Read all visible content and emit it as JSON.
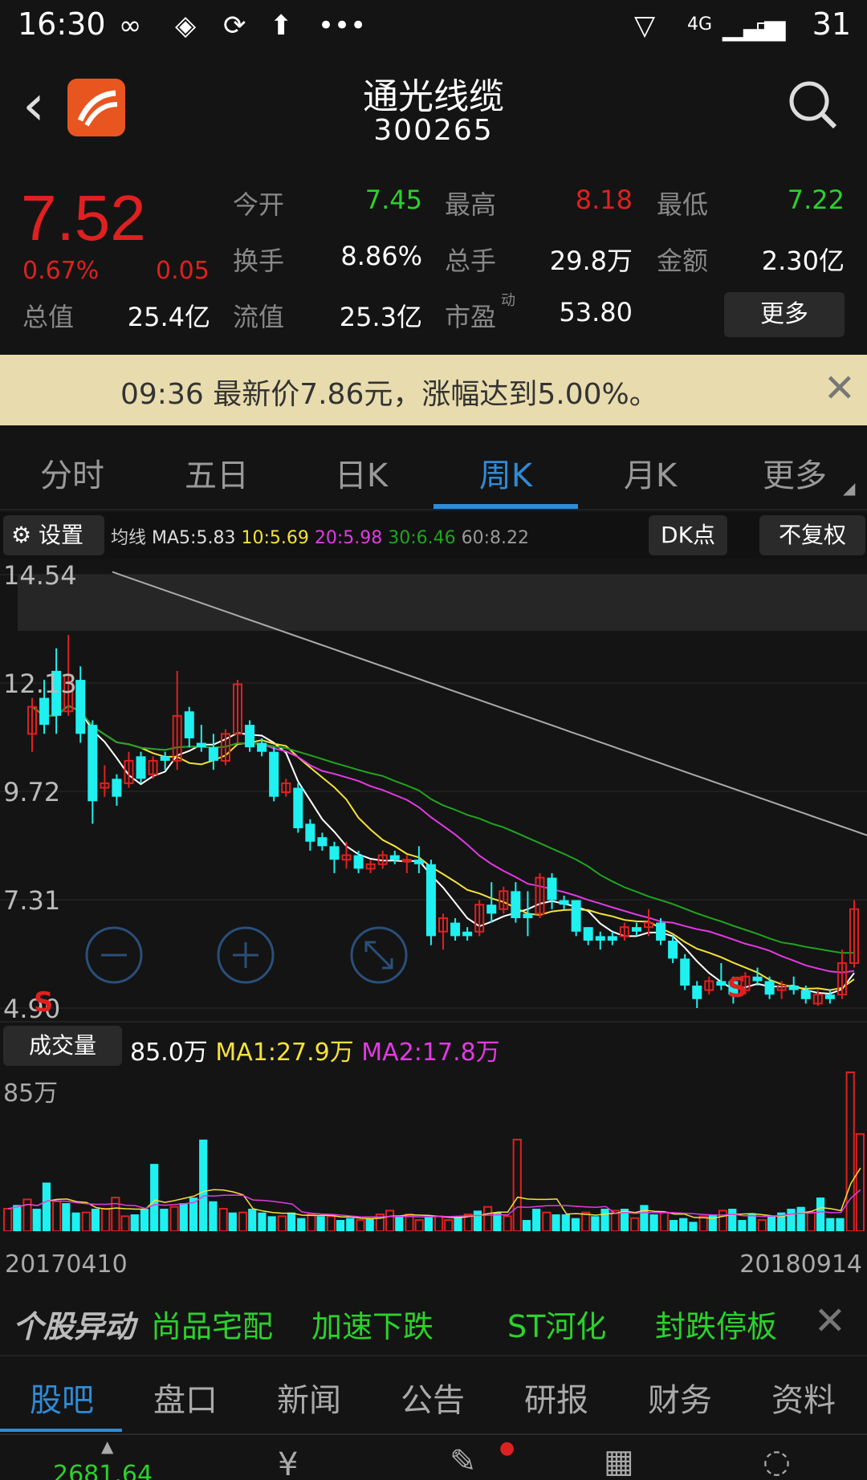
{
  "status": {
    "time": "16:30",
    "battery": "31",
    "network": "4G"
  },
  "header": {
    "name": "通光线缆",
    "code": "300265"
  },
  "quote": {
    "price": "7.52",
    "pct": "0.67%",
    "chg": "0.05",
    "rows": [
      {
        "label": "今开",
        "value": "7.45",
        "color": "green"
      },
      {
        "label": "最高",
        "value": "8.18",
        "color": "red"
      },
      {
        "label": "最低",
        "value": "7.22",
        "color": "green"
      },
      {
        "label": "换手",
        "value": "8.86%",
        "color": "white"
      },
      {
        "label": "总手",
        "value": "29.8万",
        "color": "white"
      },
      {
        "label": "金额",
        "value": "2.30亿",
        "color": "white"
      },
      {
        "label": "总值",
        "value": "25.4亿",
        "color": "white"
      },
      {
        "label": "流值",
        "value": "25.3亿",
        "color": "white"
      },
      {
        "label": "市盈",
        "value": "53.80",
        "color": "white",
        "sup": "动"
      }
    ],
    "more_btn": "更多"
  },
  "alert": {
    "text": "09:36 最新价7.86元，涨幅达到5.00%。"
  },
  "tabs": [
    "分时",
    "五日",
    "日K",
    "周K",
    "月K",
    "更多"
  ],
  "active_tab": "周K",
  "ma_bar": {
    "settings": "设置",
    "label": "均线",
    "ma5": "MA5:5.83",
    "ma10": "10:5.69",
    "ma20": "20:5.98",
    "ma30": "30:6.46",
    "ma60": "60:8.22",
    "dk": "DK点",
    "fq": "不复权"
  },
  "colors": {
    "ma5": "#ffffff",
    "ma10": "#f4e23a",
    "ma20": "#e23ae2",
    "ma30": "#1fa51f",
    "ma60": "#aaaaaa",
    "up": "#e02020",
    "down": "#1ff0f0"
  },
  "chart_labels": {
    "y": [
      "14.54",
      "12.13",
      "9.72",
      "7.31",
      "4.90"
    ],
    "s_marks": [
      "S",
      "S"
    ]
  },
  "volume": {
    "btn": "成交量",
    "vol": "85.0万",
    "ma1": "MA1:27.9万",
    "ma2": "MA2:17.8万",
    "max_label": "85万"
  },
  "dates": {
    "start": "20170410",
    "end": "20180914"
  },
  "movers": {
    "label": "个股异动",
    "items": [
      "尚品宅配",
      "加速下跌",
      "ST河化",
      "封跌停板"
    ]
  },
  "bottom_tabs": [
    "股吧",
    "盘口",
    "新闻",
    "公告",
    "研报",
    "财务",
    "资料"
  ],
  "index_value": "2681.64",
  "chart_data": {
    "type": "candlestick",
    "ylim": [
      4.9,
      14.54
    ],
    "candles": [
      [
        11.0,
        11.6,
        10.6,
        11.8
      ],
      [
        11.8,
        11.2,
        11.0,
        12.2
      ],
      [
        12.4,
        11.4,
        11.0,
        12.9
      ],
      [
        11.5,
        12.3,
        11.4,
        13.2
      ],
      [
        12.2,
        11.0,
        10.8,
        12.5
      ],
      [
        11.2,
        9.5,
        9.0,
        11.3
      ],
      [
        9.8,
        9.9,
        9.6,
        10.3
      ],
      [
        10.0,
        9.6,
        9.4,
        10.1
      ],
      [
        9.9,
        10.4,
        9.8,
        10.6
      ],
      [
        10.5,
        10.0,
        9.9,
        10.6
      ],
      [
        10.1,
        10.4,
        10.0,
        10.5
      ],
      [
        10.5,
        10.4,
        10.2,
        10.6
      ],
      [
        10.4,
        11.4,
        10.2,
        12.4
      ],
      [
        11.5,
        10.9,
        10.7,
        11.6
      ],
      [
        10.8,
        10.7,
        10.6,
        11.2
      ],
      [
        10.7,
        10.4,
        10.2,
        11.0
      ],
      [
        10.4,
        11.0,
        10.3,
        11.1
      ],
      [
        11.0,
        12.1,
        10.8,
        12.2
      ],
      [
        11.2,
        10.7,
        10.6,
        11.3
      ],
      [
        10.8,
        10.6,
        10.5,
        10.9
      ],
      [
        10.6,
        9.6,
        9.5,
        10.7
      ],
      [
        9.7,
        9.9,
        9.6,
        10.0
      ],
      [
        9.8,
        8.9,
        8.8,
        9.9
      ],
      [
        9.0,
        8.6,
        8.4,
        9.1
      ],
      [
        8.7,
        8.5,
        8.4,
        8.8
      ],
      [
        8.5,
        8.2,
        7.9,
        8.6
      ],
      [
        8.2,
        8.3,
        8.0,
        8.6
      ],
      [
        8.3,
        8.0,
        7.9,
        8.4
      ],
      [
        8.0,
        8.1,
        7.9,
        8.2
      ],
      [
        8.1,
        8.3,
        8.0,
        8.4
      ],
      [
        8.3,
        8.2,
        8.1,
        8.4
      ],
      [
        8.2,
        8.2,
        7.9,
        8.3
      ],
      [
        8.2,
        8.1,
        7.9,
        8.5
      ],
      [
        8.1,
        6.5,
        6.3,
        8.2
      ],
      [
        6.6,
        6.9,
        6.2,
        7.0
      ],
      [
        6.8,
        6.5,
        6.4,
        6.9
      ],
      [
        6.6,
        6.5,
        6.4,
        6.7
      ],
      [
        6.6,
        7.2,
        6.5,
        7.3
      ],
      [
        7.2,
        7.0,
        6.8,
        7.7
      ],
      [
        7.1,
        7.5,
        7.0,
        7.6
      ],
      [
        7.5,
        6.9,
        6.8,
        7.7
      ],
      [
        7.0,
        6.9,
        6.5,
        7.5
      ],
      [
        7.0,
        7.8,
        6.9,
        7.9
      ],
      [
        7.8,
        7.3,
        7.1,
        7.9
      ],
      [
        7.3,
        7.2,
        7.1,
        7.4
      ],
      [
        7.3,
        6.6,
        6.5,
        7.3
      ],
      [
        6.7,
        6.4,
        6.3,
        6.7
      ],
      [
        6.5,
        6.4,
        6.2,
        6.6
      ],
      [
        6.5,
        6.4,
        6.3,
        6.6
      ],
      [
        6.5,
        6.7,
        6.4,
        6.8
      ],
      [
        6.7,
        6.6,
        6.5,
        6.8
      ],
      [
        6.7,
        6.8,
        6.5,
        7.1
      ],
      [
        6.8,
        6.4,
        6.3,
        6.9
      ],
      [
        6.4,
        6.0,
        5.9,
        6.5
      ],
      [
        6.0,
        5.4,
        5.3,
        6.1
      ],
      [
        5.4,
        5.1,
        4.9,
        5.5
      ],
      [
        5.3,
        5.5,
        5.2,
        5.6
      ],
      [
        5.5,
        5.4,
        5.3,
        5.9
      ],
      [
        5.5,
        5.2,
        5.0,
        5.6
      ],
      [
        5.3,
        5.6,
        5.2,
        5.7
      ],
      [
        5.6,
        5.5,
        5.4,
        5.8
      ],
      [
        5.5,
        5.2,
        5.1,
        5.6
      ],
      [
        5.3,
        5.4,
        5.1,
        5.5
      ],
      [
        5.4,
        5.3,
        5.2,
        5.6
      ],
      [
        5.3,
        5.1,
        5.0,
        5.4
      ],
      [
        5.0,
        5.2,
        4.95,
        5.3
      ],
      [
        5.2,
        5.1,
        5.0,
        5.3
      ],
      [
        5.2,
        5.9,
        5.1,
        6.2
      ],
      [
        5.9,
        7.1,
        5.8,
        7.3
      ]
    ],
    "volume_max": 85,
    "volume": [
      12,
      14,
      17,
      12,
      26,
      16,
      15,
      10,
      10,
      12,
      12,
      18,
      8,
      9,
      12,
      36,
      12,
      13,
      15,
      18,
      49,
      16,
      12,
      10,
      10,
      12,
      10,
      8,
      8,
      10,
      7,
      9,
      8,
      8,
      6,
      7,
      6,
      7,
      9,
      11,
      8,
      9,
      6,
      8,
      8,
      6,
      8,
      9,
      11,
      13,
      10,
      8,
      49,
      6,
      12,
      10,
      9,
      9,
      7,
      10,
      8,
      12,
      11,
      12,
      7,
      14,
      9,
      10,
      6,
      7,
      5,
      8,
      9,
      11,
      12,
      6,
      9,
      6,
      8,
      10,
      12,
      13,
      10,
      18,
      7,
      7,
      85,
      52
    ],
    "volume_up": [
      1,
      0,
      1,
      0,
      0,
      1,
      0,
      0,
      1,
      0,
      1,
      1,
      1,
      0,
      0,
      0,
      0,
      1,
      0,
      0,
      0,
      0,
      1,
      0,
      1,
      0,
      0,
      0,
      1,
      0,
      0,
      1,
      0,
      1,
      0,
      0,
      1,
      0,
      1,
      1,
      0,
      1,
      1,
      0,
      1,
      1,
      0,
      1,
      0,
      1,
      0,
      1,
      1,
      0,
      0,
      1,
      0,
      0,
      0,
      1,
      0,
      0,
      1,
      0,
      1,
      0,
      0,
      1,
      0,
      0,
      0,
      1,
      0,
      1,
      0,
      0,
      0,
      1,
      0,
      0,
      0,
      0,
      1,
      0,
      0,
      0,
      1,
      1
    ]
  }
}
